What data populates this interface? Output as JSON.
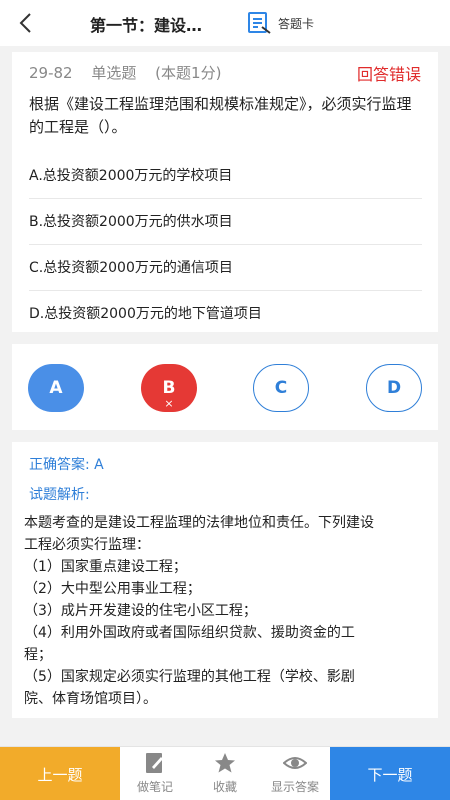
{
  "header": {
    "title": "第一节：建设…",
    "card_label": "答题卡"
  },
  "question": {
    "number": "29-82",
    "type": "单选题",
    "score": "(本题1分)",
    "result": "回答错误",
    "stem": "根据《建设工程监理范围和规模标准规定》，必须实行监理的工程是（）。",
    "options": [
      "A.总投资额2000万元的学校项目",
      "B.总投资额2000万元的供水项目",
      "C.总投资额2000万元的通信项目",
      "D.总投资额2000万元的地下管道项目"
    ]
  },
  "choices": [
    {
      "letter": "A",
      "state": "correct"
    },
    {
      "letter": "B",
      "state": "wrong",
      "mark": "×"
    },
    {
      "letter": "C",
      "state": "plain"
    },
    {
      "letter": "D",
      "state": "plain"
    }
  ],
  "explanation": {
    "correct_answer": "正确答案: A",
    "analysis_label": "试题解析:",
    "lines": [
      "本题考查的是建设工程监理的法律地位和责任。下列建设",
      "工程必须实行监理：",
      "（1）国家重点建设工程；",
      "（2）大中型公用事业工程；",
      "（3）成片开发建设的住宅小区工程；",
      "（4）利用外国政府或者国际组织贷款、援助资金的工",
      "程；",
      "（5）国家规定必须实行监理的其他工程（学校、影剧",
      "院、体育场馆项目）。"
    ]
  },
  "bottom": {
    "prev_label": "上一题",
    "note_label": "做笔记",
    "fav_label": "收藏",
    "show_label": "显示答案",
    "next_label": "下一题"
  },
  "colors": {
    "accent_blue": "#2e86e6",
    "wrong_red": "#e53935",
    "prev_orange": "#f2ab2a"
  }
}
